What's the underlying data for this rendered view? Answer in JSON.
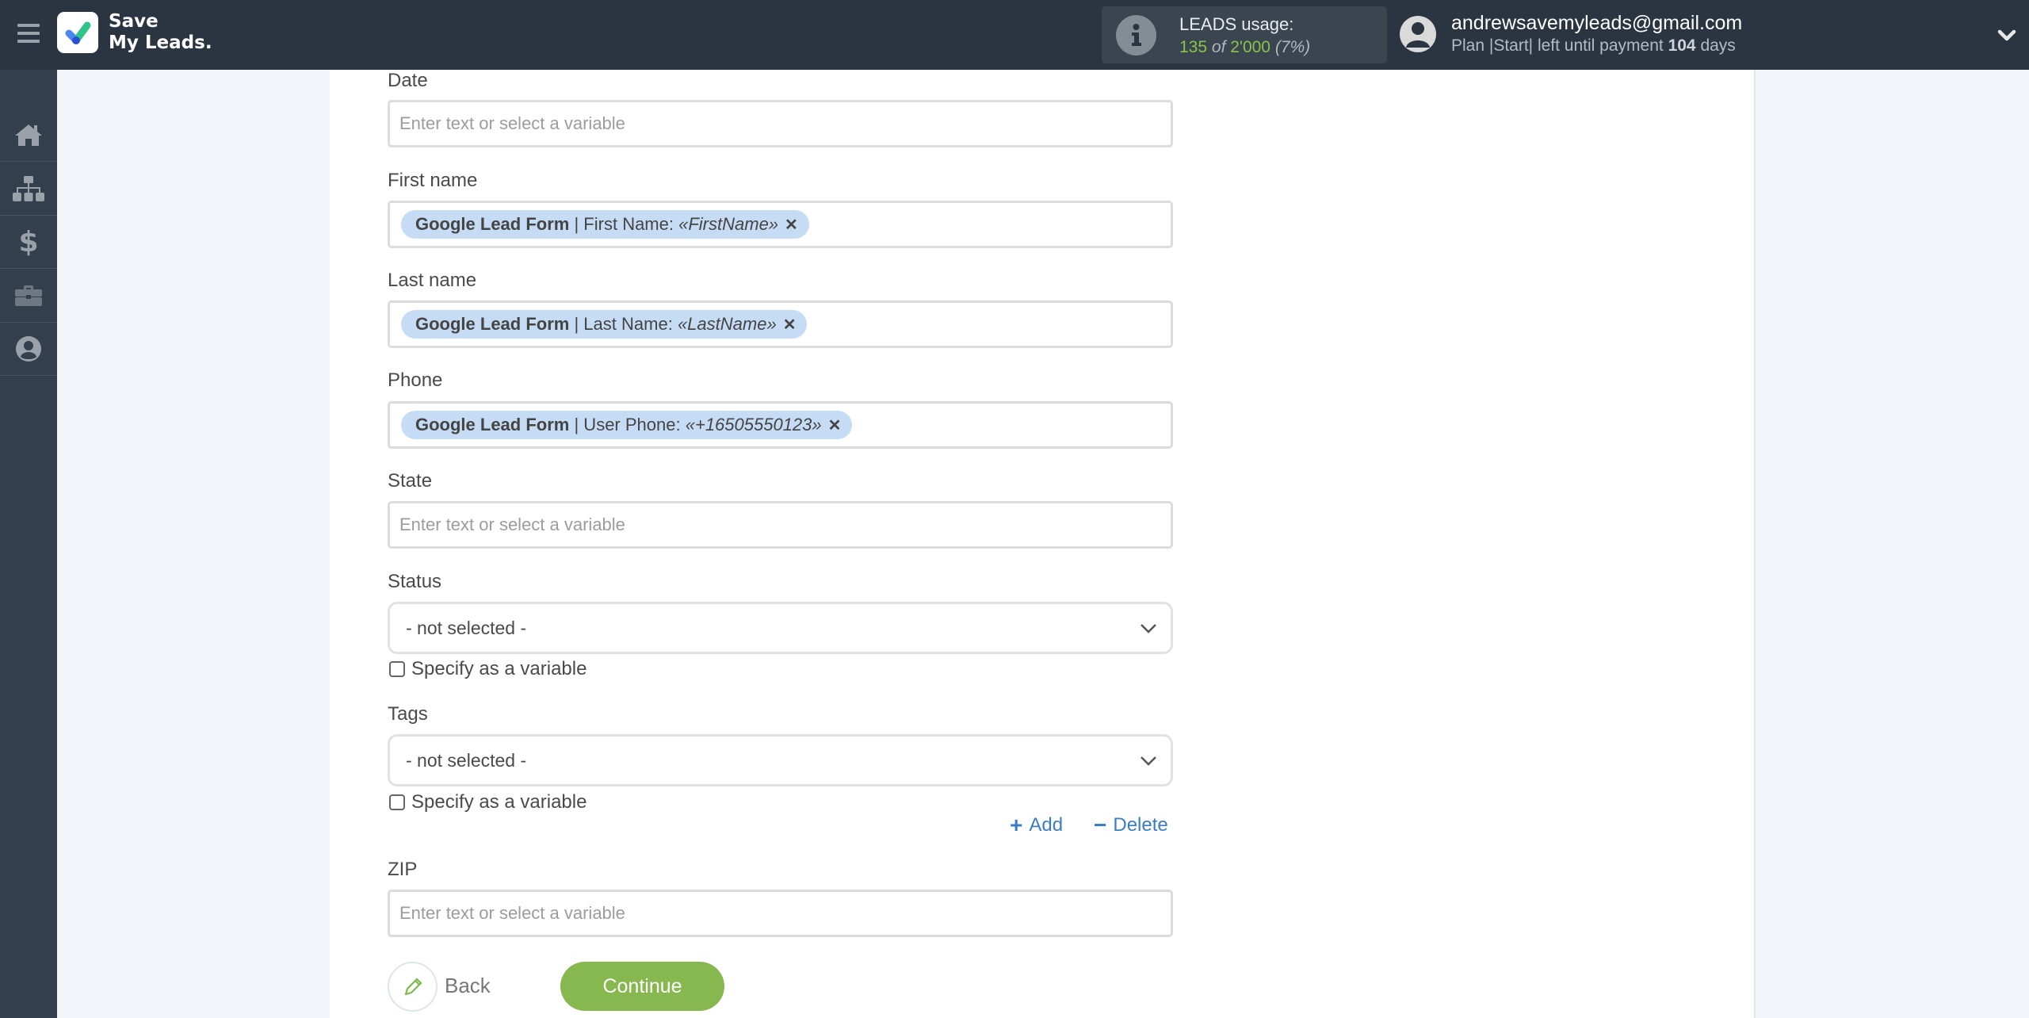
{
  "header": {
    "logo": {
      "line1": "Save",
      "line2": "My Leads."
    },
    "usage": {
      "label": "LEADS usage:",
      "used": "135",
      "of": "of",
      "limit": "2'000",
      "percent": "(7%)"
    },
    "user": {
      "email": "andrewsavemyleads@gmail.com",
      "plan_prefix": "Plan |Start| left until payment",
      "days": "104",
      "days_suffix": "days"
    }
  },
  "sidebar": {
    "items": [
      {
        "icon": "home-icon",
        "label": "Home"
      },
      {
        "icon": "sitemap-icon",
        "label": "Connections"
      },
      {
        "icon": "dollar-icon",
        "label": "Billing"
      },
      {
        "icon": "briefcase-icon",
        "label": "Tools"
      },
      {
        "icon": "user-circle-icon",
        "label": "Account"
      }
    ]
  },
  "form": {
    "placeholder": "Enter text or select a variable",
    "fields": {
      "date": {
        "label": "Date"
      },
      "first_name": {
        "label": "First name",
        "chip": {
          "source": "Google Lead Form",
          "field": "| First Name:",
          "value": "«FirstName»"
        }
      },
      "last_name": {
        "label": "Last name",
        "chip": {
          "source": "Google Lead Form",
          "field": "| Last Name:",
          "value": "«LastName»"
        }
      },
      "phone": {
        "label": "Phone",
        "chip": {
          "source": "Google Lead Form",
          "field": "| User Phone:",
          "value": "«+16505550123»"
        }
      },
      "state": {
        "label": "State"
      },
      "status": {
        "label": "Status",
        "selected": "- not selected -",
        "checkbox": "Specify as a variable",
        "checked": false
      },
      "tags": {
        "label": "Tags",
        "selected": "- not selected -",
        "checkbox": "Specify as a variable",
        "checked": false
      },
      "zip": {
        "label": "ZIP"
      }
    },
    "add_label": "Add",
    "delete_label": "Delete",
    "chip_remove": "✕"
  },
  "footer": {
    "back_label": "Back",
    "continue_label": "Continue"
  },
  "colors": {
    "header_bg": "#2b3441",
    "sidebar_bg": "#343f4d",
    "accent_green": "#87b84f",
    "link_blue": "#3b7dc4",
    "chip_bg": "#c6dcf4"
  }
}
